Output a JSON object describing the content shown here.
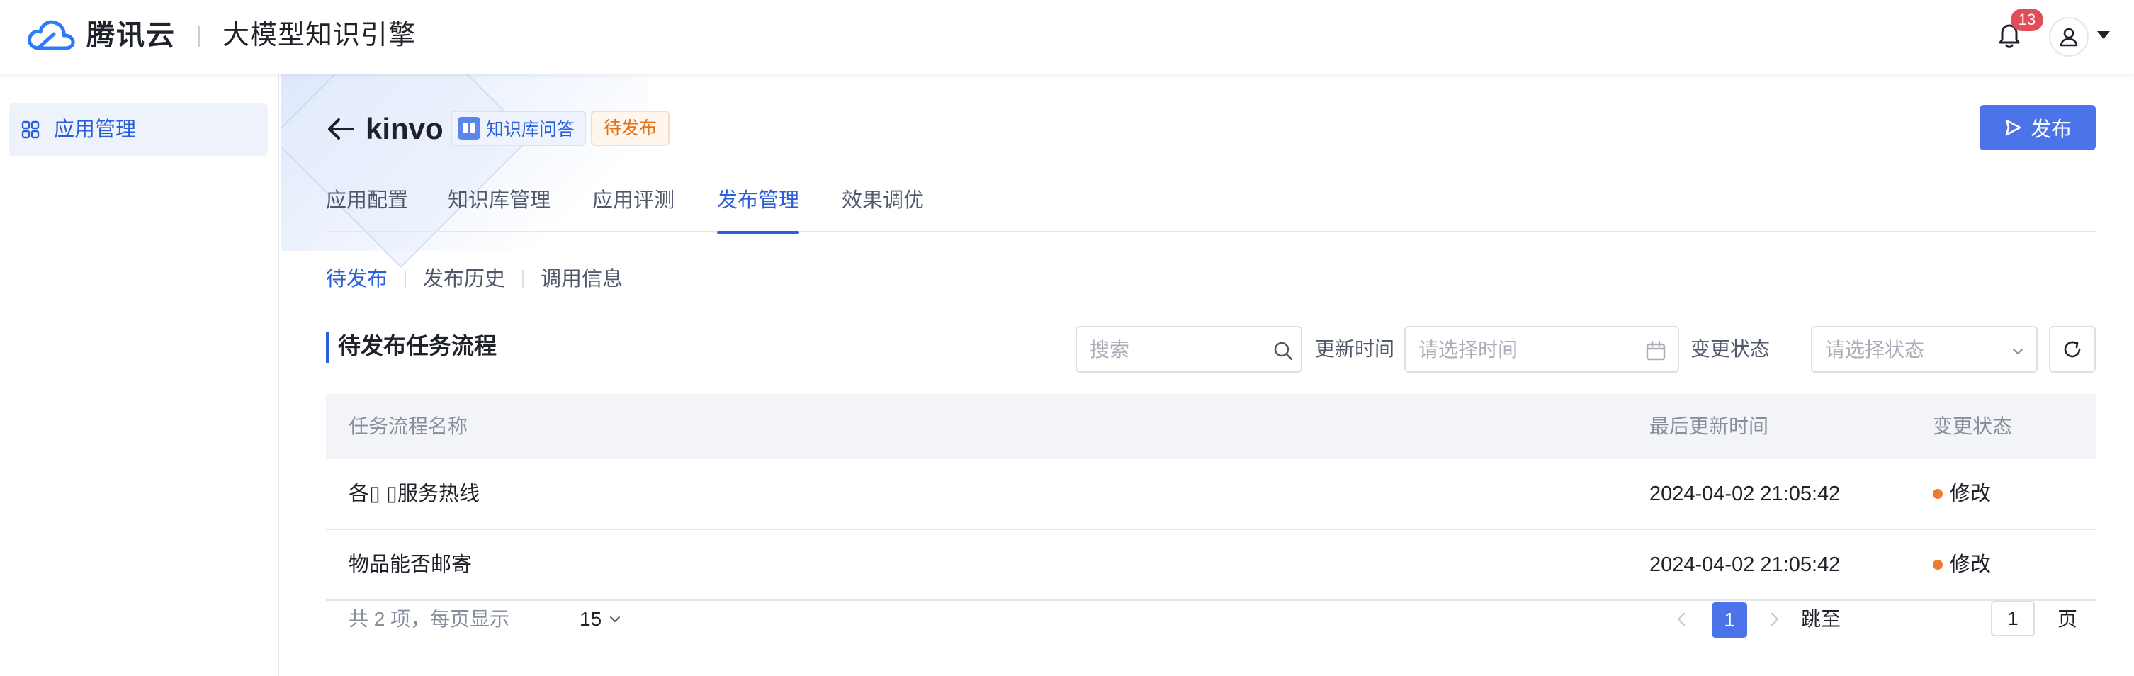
{
  "header": {
    "brand": "腾讯云",
    "product": "大模型知识引擎",
    "notification_count": "13",
    "icons": {
      "logo": "tencent-cloud-logo",
      "bell": "bell-icon",
      "user": "user-icon"
    }
  },
  "sidebar": {
    "items": [
      {
        "label": "应用管理",
        "icon": "grid-icon",
        "active": true
      }
    ]
  },
  "app": {
    "name": "kinvo",
    "type_tag": "知识库问答",
    "status_tag": "待发布",
    "publish_label": "发布"
  },
  "tabs": [
    {
      "label": "应用配置"
    },
    {
      "label": "知识库管理"
    },
    {
      "label": "应用评测"
    },
    {
      "label": "发布管理",
      "active": true
    },
    {
      "label": "效果调优"
    }
  ],
  "subtabs": [
    {
      "label": "待发布",
      "active": true
    },
    {
      "label": "发布历史"
    },
    {
      "label": "调用信息"
    }
  ],
  "section": {
    "title": "待发布任务流程"
  },
  "filters": {
    "search_placeholder": "搜索",
    "time_label": "更新时间",
    "time_placeholder": "请选择时间",
    "status_label": "变更状态",
    "status_placeholder": "请选择状态"
  },
  "table": {
    "columns": [
      "任务流程名称",
      "最后更新时间",
      "变更状态"
    ],
    "rows": [
      {
        "name": "各▯  ▯服务热线",
        "updated": "2024-04-02 21:05:42",
        "status": "修改"
      },
      {
        "name": "物品能否邮寄",
        "updated": "2024-04-02 21:05:42",
        "status": "修改"
      }
    ]
  },
  "pagination": {
    "total_text": "共 2 项，每页显示",
    "page_size": "15",
    "current_page": "1",
    "jump_label": "跳至",
    "jump_value": "1",
    "jump_unit": "页"
  },
  "colors": {
    "accent": "#2b5fd9",
    "primary_button": "#4c74ea",
    "pending_tag": "#e37318",
    "status_modified": "#ed7b2f",
    "badge": "#e34d59"
  }
}
